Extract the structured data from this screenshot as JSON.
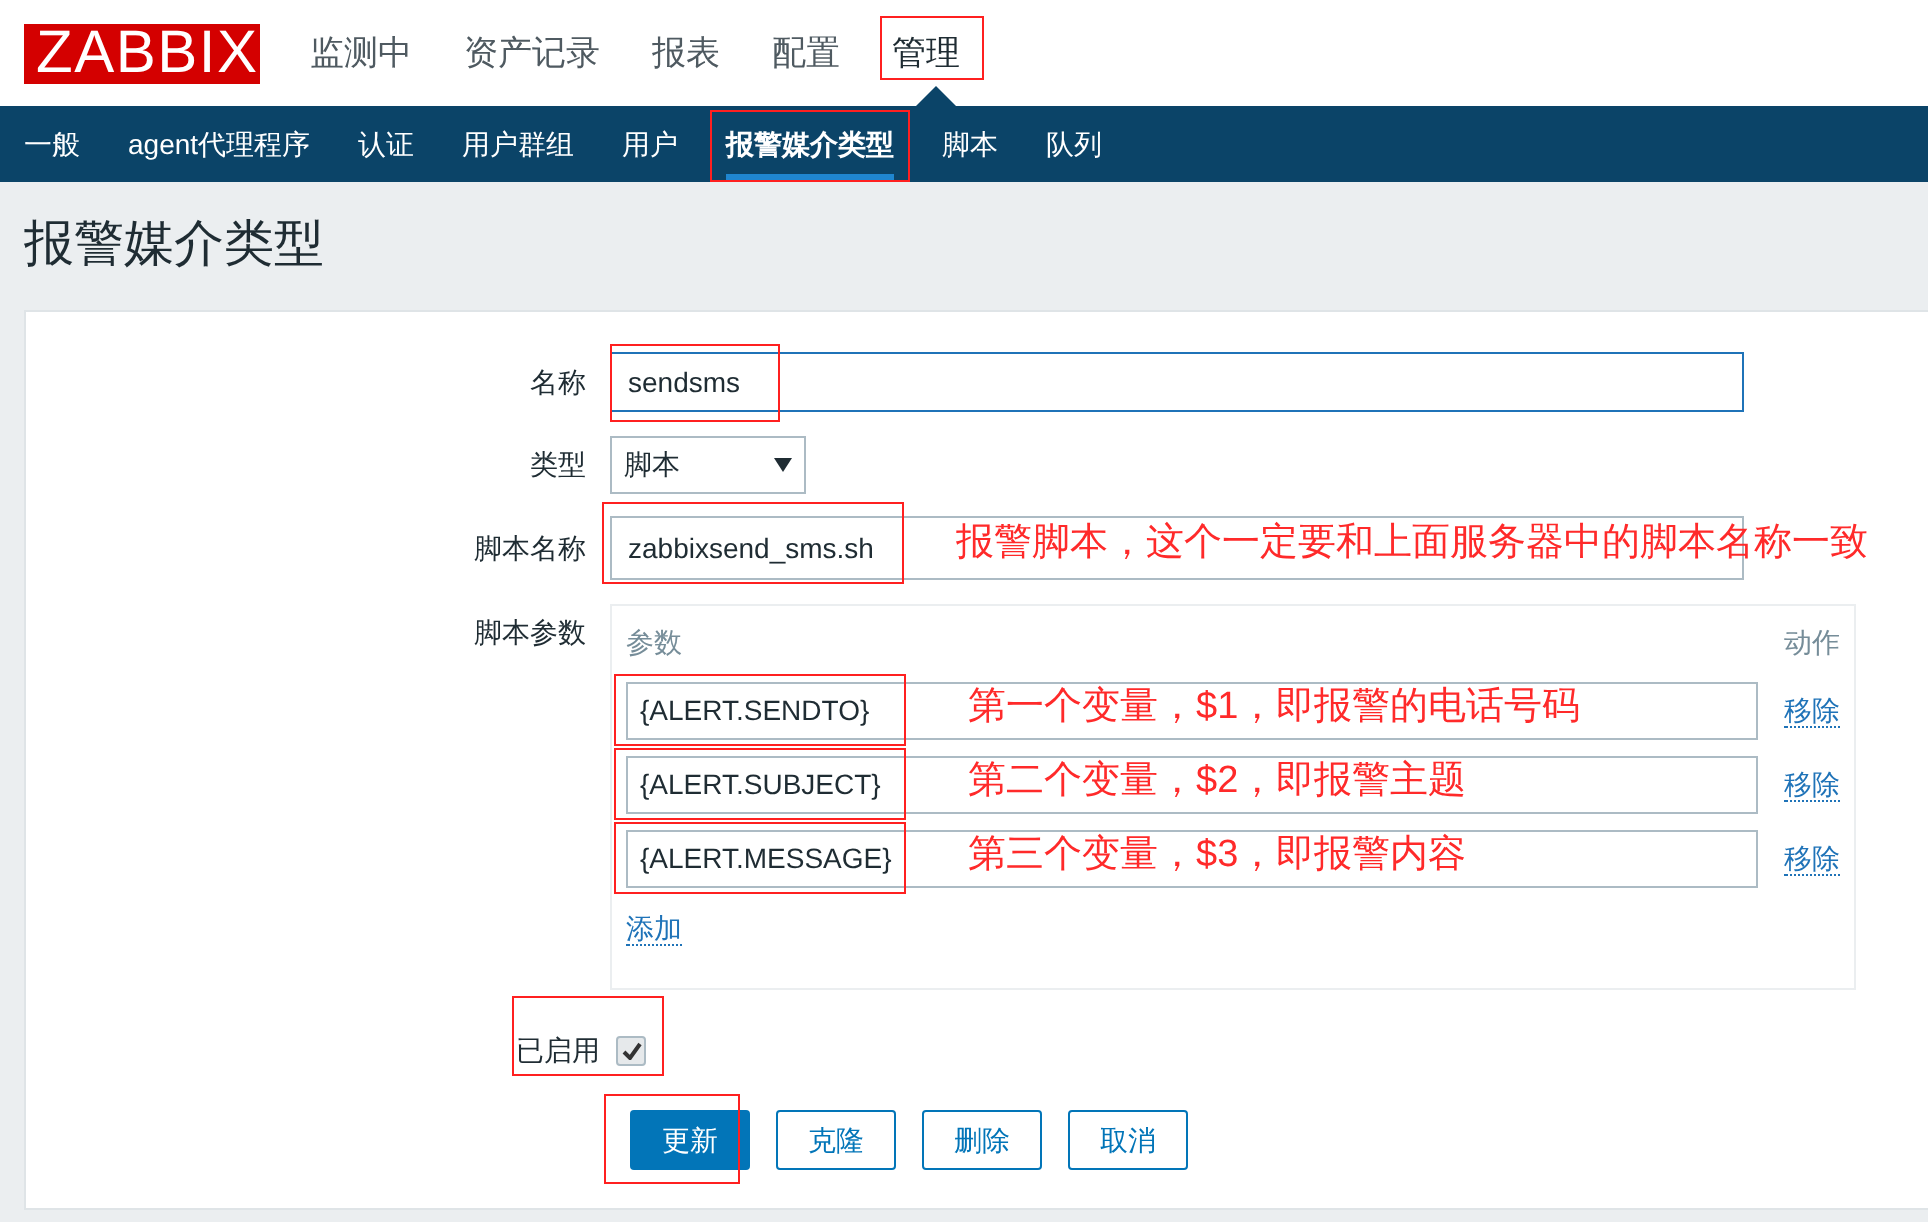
{
  "logo": "ZABBIX",
  "top_menu": [
    {
      "label": "监测中",
      "selected": false,
      "highlighted": false
    },
    {
      "label": "资产记录",
      "selected": false,
      "highlighted": false
    },
    {
      "label": "报表",
      "selected": false,
      "highlighted": false
    },
    {
      "label": "配置",
      "selected": false,
      "highlighted": false
    },
    {
      "label": "管理",
      "selected": true,
      "highlighted": true
    }
  ],
  "sub_menu": [
    {
      "label": "一般",
      "selected": false,
      "highlighted": false
    },
    {
      "label": "agent代理程序",
      "selected": false,
      "highlighted": false
    },
    {
      "label": "认证",
      "selected": false,
      "highlighted": false
    },
    {
      "label": "用户群组",
      "selected": false,
      "highlighted": false
    },
    {
      "label": "用户",
      "selected": false,
      "highlighted": false
    },
    {
      "label": "报警媒介类型",
      "selected": true,
      "highlighted": true
    },
    {
      "label": "脚本",
      "selected": false,
      "highlighted": false
    },
    {
      "label": "队列",
      "selected": false,
      "highlighted": false
    }
  ],
  "page_title": "报警媒介类型",
  "form": {
    "name": {
      "label": "名称",
      "value": "sendsms",
      "highlighted": true
    },
    "type": {
      "label": "类型",
      "value": "脚本"
    },
    "script_name": {
      "label": "脚本名称",
      "value": "zabbixsend_sms.sh",
      "highlighted": true,
      "note": "报警脚本，这个一定要和上面服务器中的脚本名称一致"
    },
    "script_params": {
      "label": "脚本参数",
      "column_1": "参数",
      "column_2": "动作",
      "add_link": "添加",
      "rows": [
        {
          "value": "{ALERT.SENDTO}",
          "action": "移除",
          "highlighted": true,
          "note": "第一个变量，$1，即报警的电话号码"
        },
        {
          "value": "{ALERT.SUBJECT}",
          "action": "移除",
          "highlighted": true,
          "note": "第二个变量，$2，即报警主题"
        },
        {
          "value": "{ALERT.MESSAGE}",
          "action": "移除",
          "highlighted": true,
          "note": "第三个变量，$3，即报警内容"
        }
      ]
    },
    "enabled": {
      "label": "已启用",
      "checked": true,
      "highlighted": true
    },
    "buttons": [
      {
        "label": "更新",
        "kind": "primary",
        "highlighted": true
      },
      {
        "label": "克隆",
        "kind": "secondary",
        "highlighted": false
      },
      {
        "label": "删除",
        "kind": "secondary",
        "highlighted": false
      },
      {
        "label": "取消",
        "kind": "secondary",
        "highlighted": false
      }
    ]
  }
}
